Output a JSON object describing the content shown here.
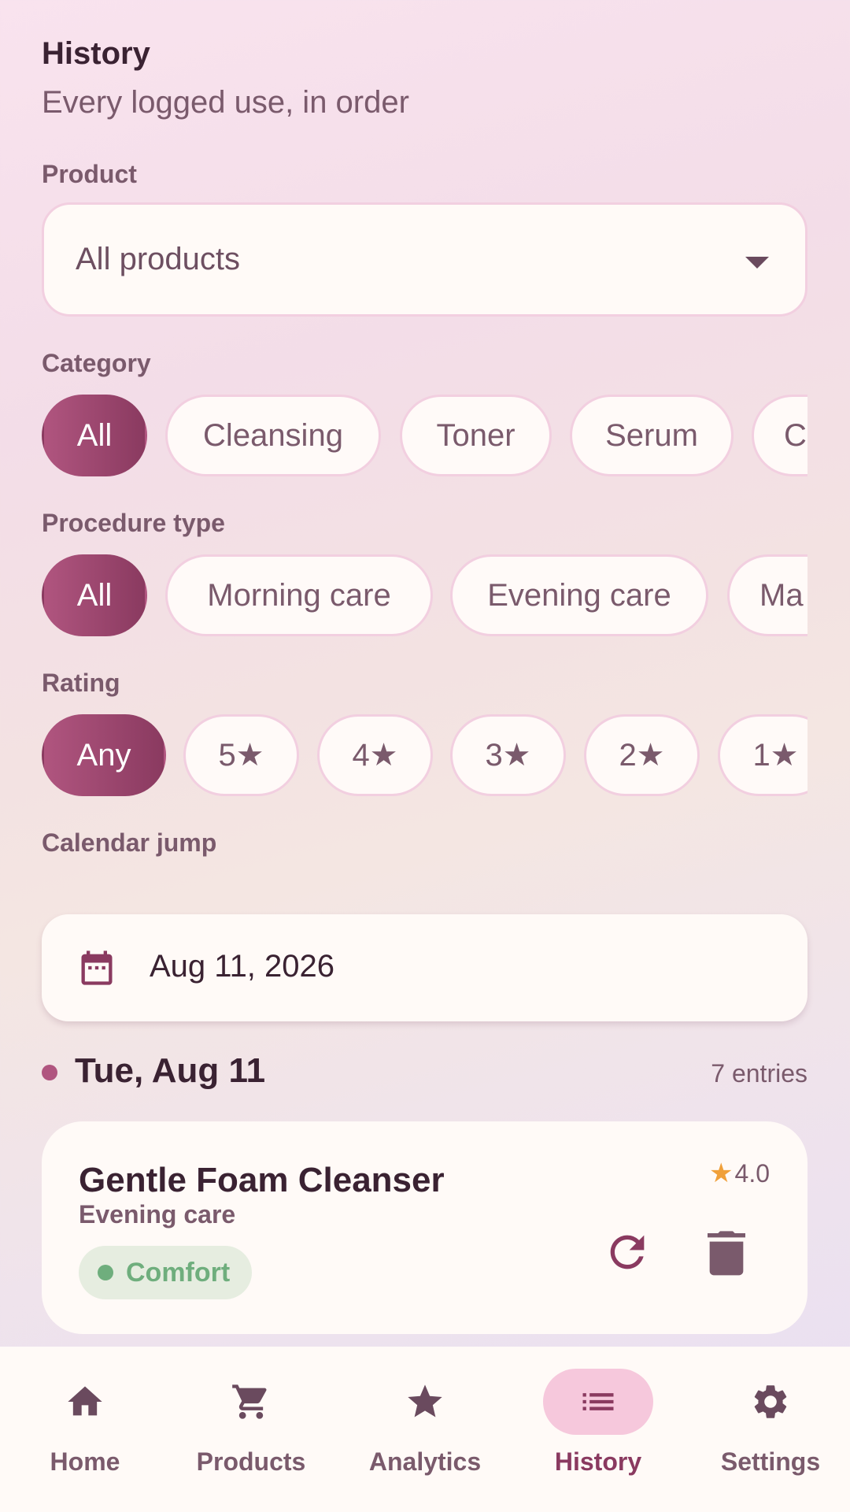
{
  "header": {
    "title": "History",
    "subtitle": "Every logged use, in order"
  },
  "filters": {
    "product_label": "Product",
    "product_value": "All products",
    "category_label": "Category",
    "category_chips": [
      "All",
      "Cleansing",
      "Toner",
      "Serum",
      "C"
    ],
    "category_selected": "All",
    "procedure_label": "Procedure type",
    "procedure_chips": [
      "All",
      "Morning care",
      "Evening care",
      "Ma"
    ],
    "procedure_selected": "All",
    "rating_label": "Rating",
    "rating_chips": [
      "Any",
      "5★",
      "4★",
      "3★",
      "2★",
      "1★"
    ],
    "rating_selected": "Any",
    "calendar_label": "Calendar jump",
    "calendar_value": "Aug 11, 2026"
  },
  "day_group": {
    "day": "Tue, Aug 11",
    "count": "7 entries"
  },
  "entries": [
    {
      "name": "Gentle Foam Cleanser",
      "procedure": "Evening care",
      "rating": "4.0",
      "feeling": "Comfort"
    }
  ],
  "nav": {
    "items": [
      {
        "label": "Home",
        "icon": "home-icon"
      },
      {
        "label": "Products",
        "icon": "cart-icon"
      },
      {
        "label": "Analytics",
        "icon": "star-icon"
      },
      {
        "label": "History",
        "icon": "list-icon"
      },
      {
        "label": "Settings",
        "icon": "gear-icon"
      }
    ],
    "active": "History"
  },
  "colors": {
    "accent": "#8a3a60",
    "accent_light": "#b0557f",
    "chip_border": "#f2cfe0",
    "positive": "#6fae7d",
    "star": "#f0a03a",
    "nav_active_pill": "#f6c8dc"
  }
}
